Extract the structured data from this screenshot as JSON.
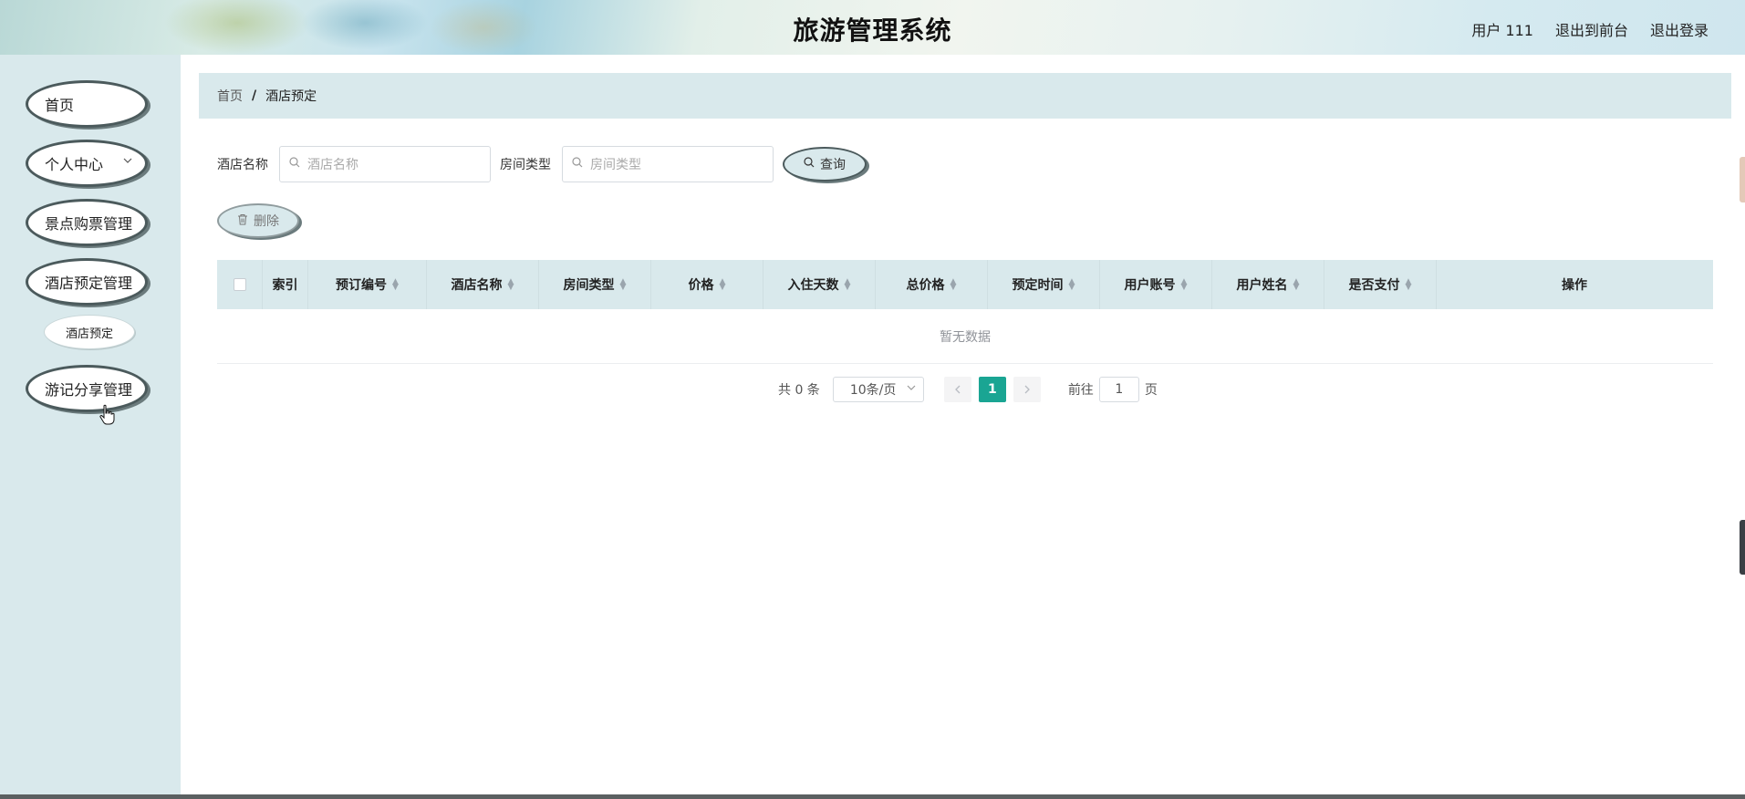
{
  "header": {
    "title": "旅游管理系统",
    "links": [
      "用户 111",
      "退出到前台",
      "退出登录"
    ]
  },
  "sidebar": {
    "items": [
      {
        "label": "首页"
      },
      {
        "label": "个人中心"
      },
      {
        "label": "景点购票管理"
      },
      {
        "label": "酒店预定管理"
      },
      {
        "label": "酒店预定"
      },
      {
        "label": "游记分享管理"
      }
    ]
  },
  "breadcrumb": {
    "home": "首页",
    "separator": "/",
    "current": "酒店预定"
  },
  "search": {
    "hotel_label": "酒店名称",
    "hotel_placeholder": "酒店名称",
    "room_label": "房间类型",
    "room_placeholder": "房间类型",
    "query_label": "查询"
  },
  "actions": {
    "delete_label": "删除"
  },
  "table": {
    "columns": [
      "索引",
      "预订编号",
      "酒店名称",
      "房间类型",
      "价格",
      "入住天数",
      "总价格",
      "预定时间",
      "用户账号",
      "用户姓名",
      "是否支付",
      "操作"
    ],
    "empty_text": "暂无数据"
  },
  "pagination": {
    "total_text": "共 0 条",
    "page_size": "10条/页",
    "current_page": "1",
    "goto_label": "前往",
    "goto_value": "1",
    "page_suffix": "页"
  },
  "colors": {
    "accent": "#1aa593",
    "panel": "#d9e9ec"
  }
}
